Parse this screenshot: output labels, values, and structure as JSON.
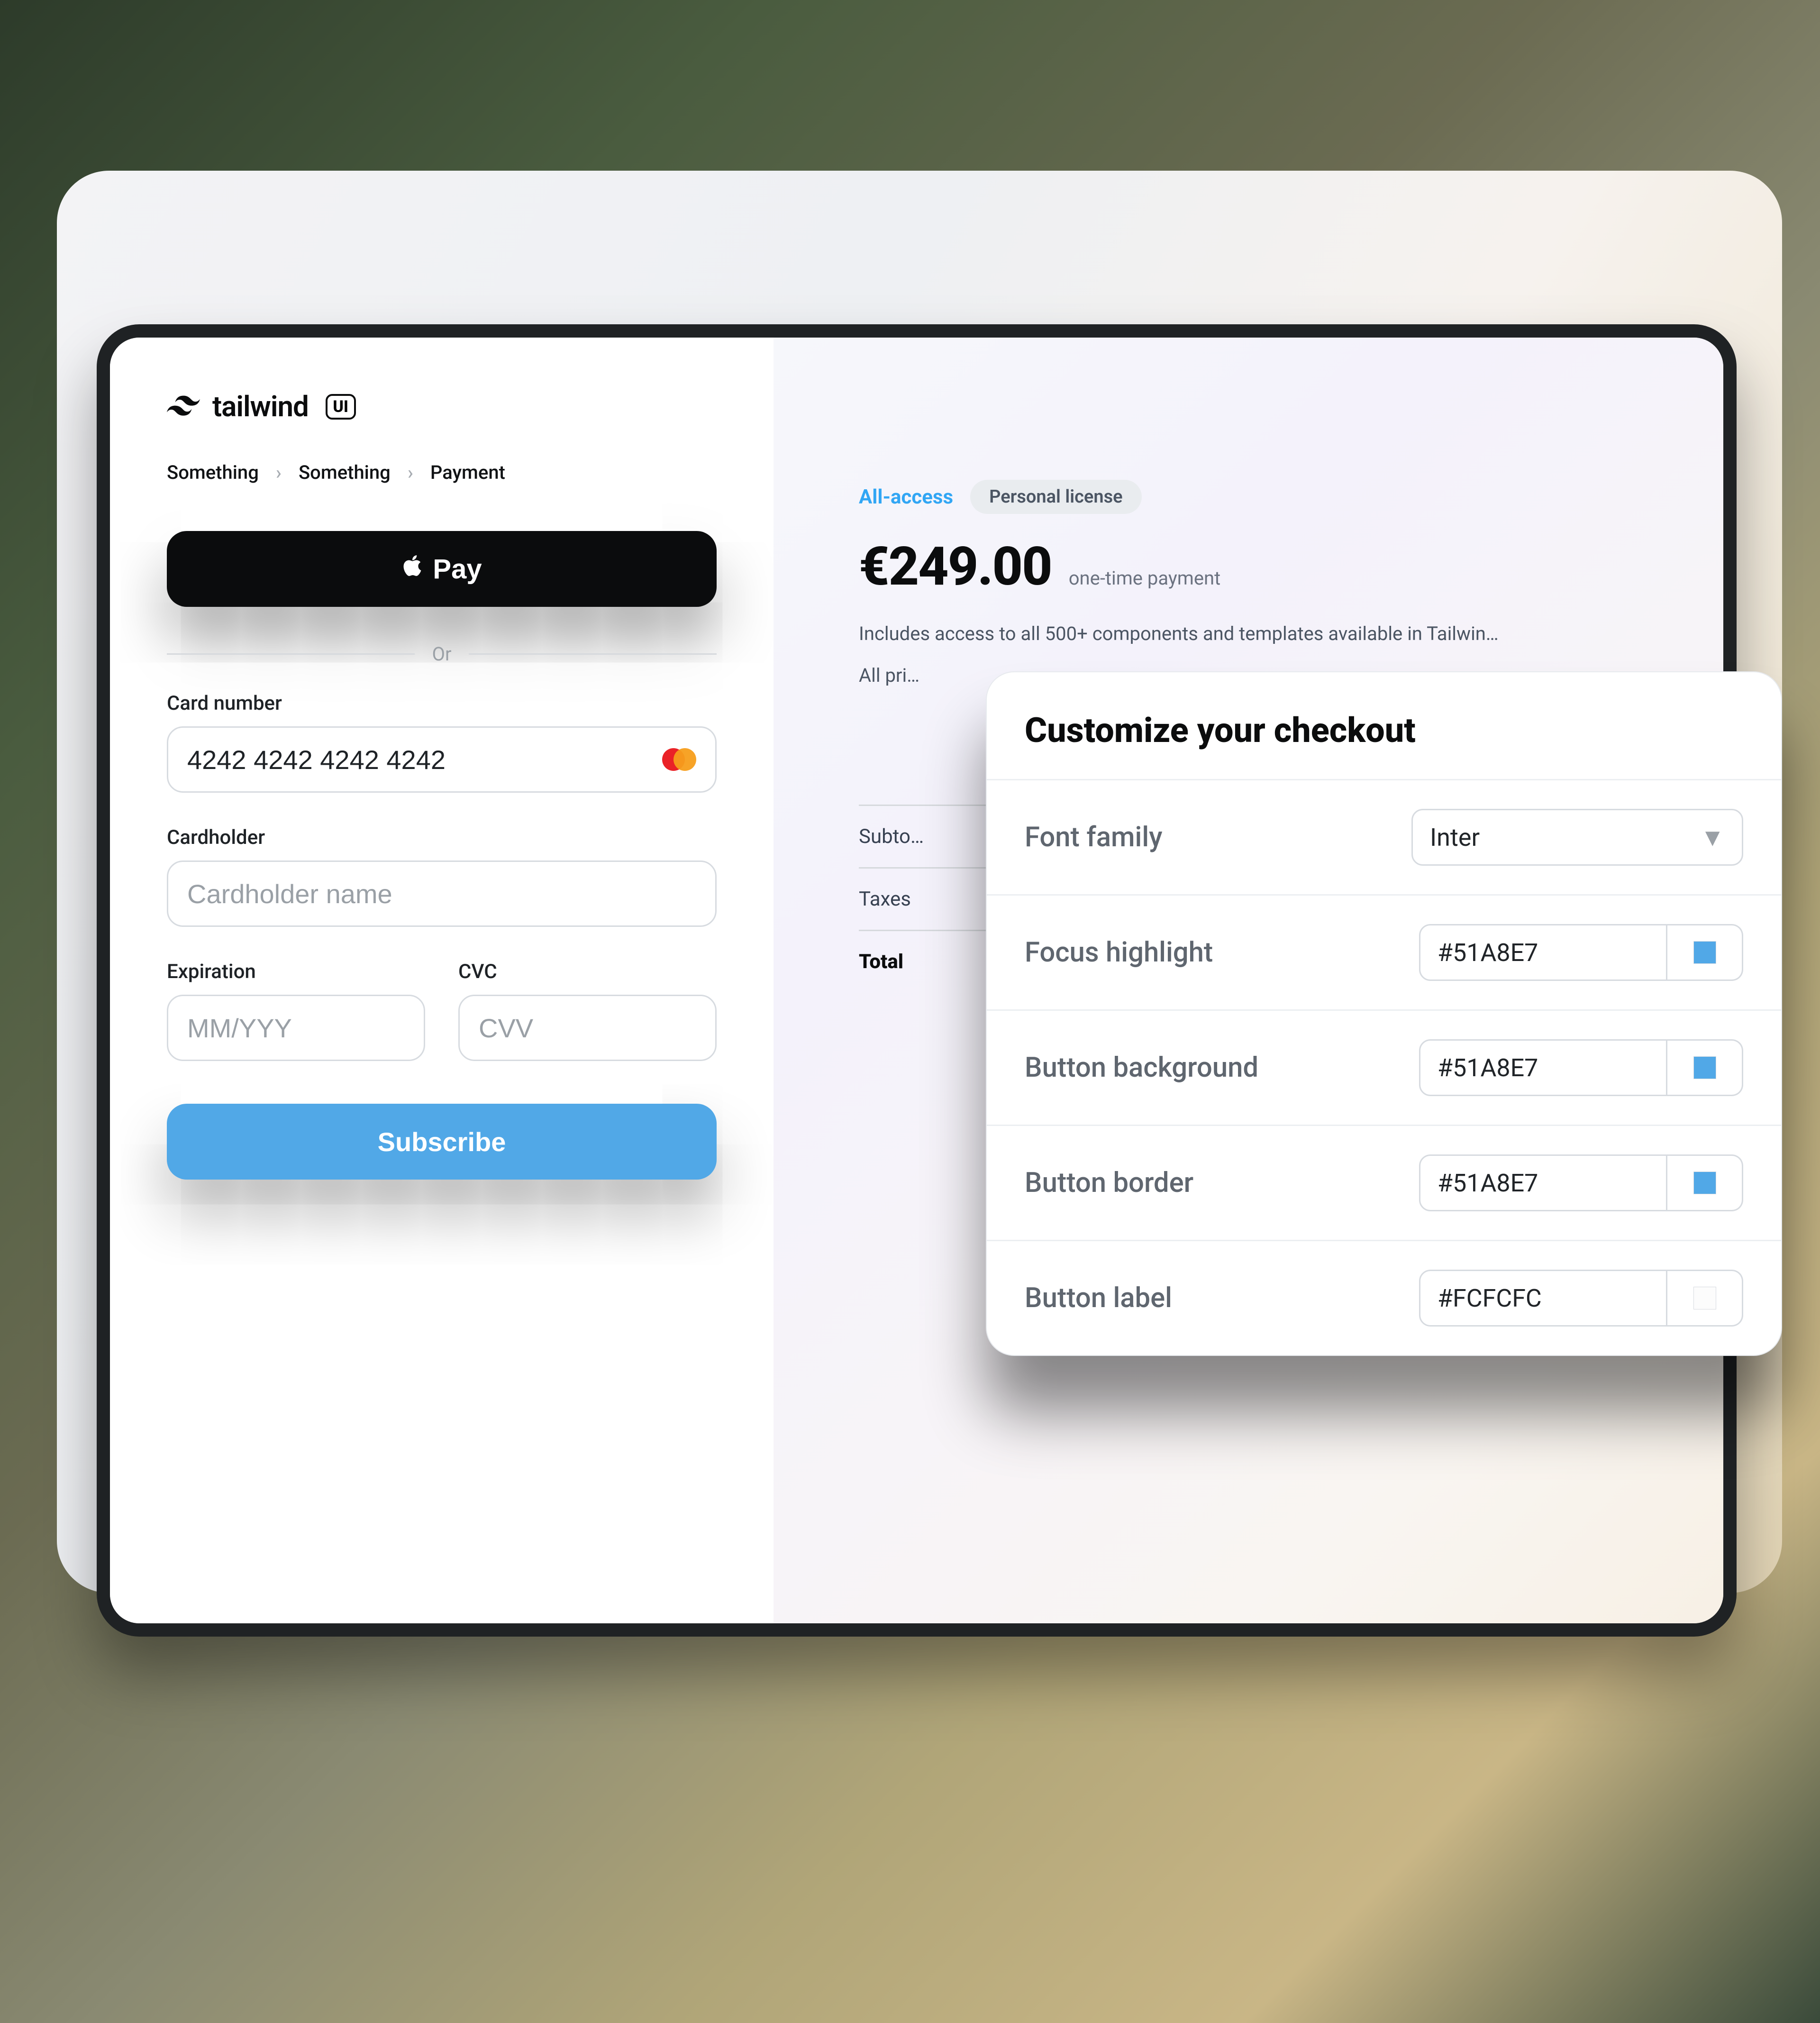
{
  "brand": {
    "name": "tailwind",
    "badge": "UI"
  },
  "breadcrumb": [
    "Something",
    "Something",
    "Payment"
  ],
  "payment": {
    "applepay_label": "Pay",
    "or_label": "Or",
    "card_number_label": "Card number",
    "card_number_value": "4242 4242 4242 4242",
    "cardholder_label": "Cardholder",
    "cardholder_placeholder": "Cardholder name",
    "expiration_label": "Expiration",
    "expiration_placeholder": "MM/YYY",
    "cvc_label": "CVC",
    "cvc_placeholder": "CVV",
    "subscribe_label": "Subscribe"
  },
  "summary": {
    "top_link": "All-access",
    "pill": "Personal license",
    "price": "€249.00",
    "price_note": "one-time payment",
    "desc1": "Includes access to all 500+ components and templates available in Tailwin…",
    "desc2": "All pri…",
    "rows": [
      {
        "label": "Subto…"
      },
      {
        "label": "Taxes"
      },
      {
        "label": "Total"
      }
    ]
  },
  "customize": {
    "title": "Customize your checkout",
    "font_family_label": "Font family",
    "font_family_value": "Inter",
    "rows": [
      {
        "label": "Focus highlight",
        "value": "#51A8E7",
        "swatch": "#51A8E7"
      },
      {
        "label": "Button background",
        "value": "#51A8E7",
        "swatch": "#51A8E7"
      },
      {
        "label": "Button border",
        "value": "#51A8E7",
        "swatch": "#51A8E7"
      },
      {
        "label": "Button label",
        "value": "#FCFCFC",
        "swatch": "#FCFCFC"
      }
    ]
  },
  "colors": {
    "accent": "#51A8E7"
  }
}
